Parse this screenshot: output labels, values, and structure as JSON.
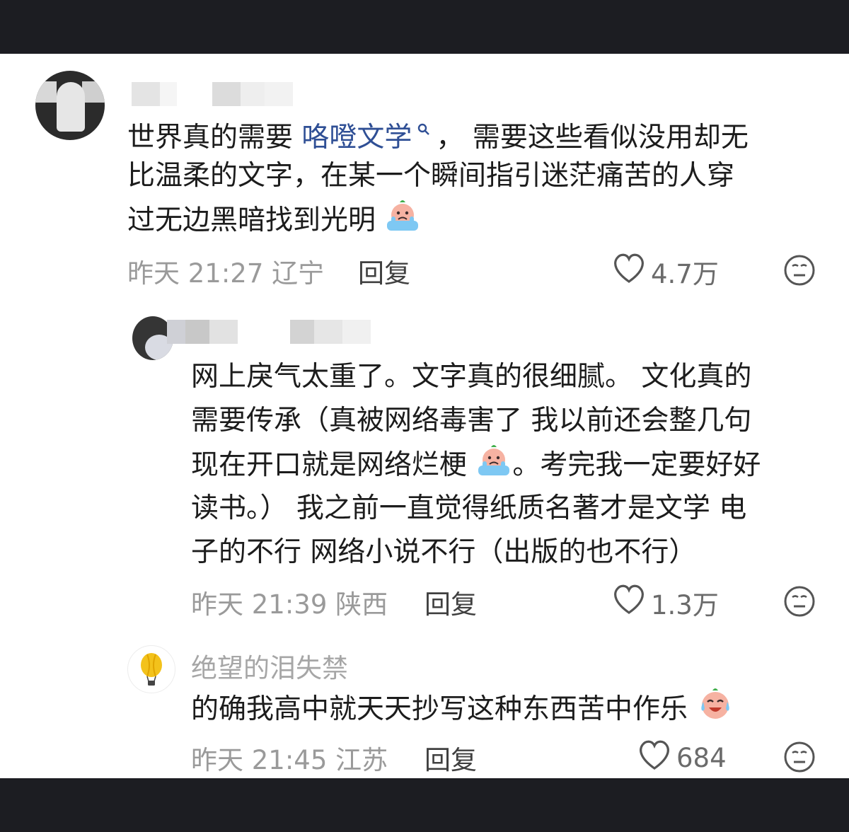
{
  "comments": [
    {
      "text_lines": [
        {
          "before": "世界真的需要 ",
          "link": "咯噔文学",
          "after": "， 需要这些看似没用却无"
        },
        {
          "text": "比温柔的文字，在某一个瞬间指引迷茫痛苦的人穿"
        },
        {
          "text": "过无边黑暗找到光明"
        }
      ],
      "date": "昨天 21:27 辽宁",
      "reply_label": "回复",
      "likes": "4.7万"
    },
    {
      "text_lines": [
        "网上戾气太重了。文字真的很细腻。 文化真的",
        "需要传承（真被网络毒害了 我以前还会整几句",
        "现在开口就是网络烂梗",
        "。考完我一定要好好",
        "读书。） 我之前一直觉得纸质名著才是文学 电",
        "子的不行 网络小说不行（出版的也不行）"
      ],
      "date": "昨天 21:39 陕西",
      "reply_label": "回复",
      "likes": "1.3万"
    },
    {
      "username": "绝望的泪失禁",
      "text": "的确我高中就天天抄写这种东西苦中作乐",
      "date": "昨天 21:45 江苏",
      "reply_label": "回复",
      "likes": "684"
    }
  ],
  "icons": {
    "like": "heart-outline-icon",
    "dislike": "neutral-face-icon",
    "search": "search-icon",
    "crying_emoji": "crying-face-emoji",
    "laughing_crying_emoji": "laugh-cry-emoji",
    "balloon_avatar": "hot-air-balloon-icon"
  },
  "colors": {
    "link": "#2f4f95",
    "meta": "#9a9a9a",
    "bars": "#1c1d22"
  }
}
